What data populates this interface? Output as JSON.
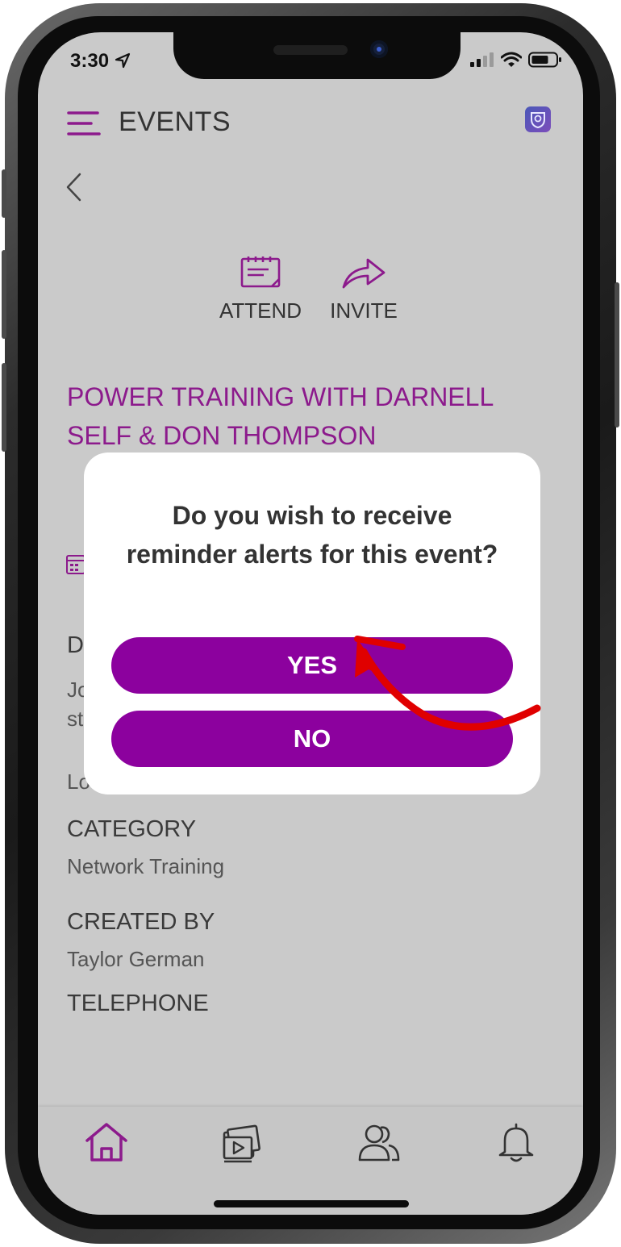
{
  "status_bar": {
    "time": "3:30"
  },
  "header": {
    "title": "EVENTS"
  },
  "actions": {
    "attend_label": "ATTEND",
    "invite_label": "INVITE"
  },
  "event": {
    "title_line1": "POWER TRAINING WITH DARNELL",
    "title_line2": "SELF & DON THOMPSON",
    "description_label_partial": "D",
    "description_line1_partial": "Jo",
    "description_line2_partial": "st",
    "location_partial": "Lo",
    "category_label": "CATEGORY",
    "category_value": "Network Training",
    "created_by_label": "CREATED BY",
    "created_by_value": "Taylor German",
    "telephone_label": "TELEPHONE"
  },
  "modal": {
    "question_line1": "Do you wish to receive",
    "question_line2": "reminder alerts for this event?",
    "yes_label": "YES",
    "no_label": "NO"
  },
  "bottom_nav": {
    "items": [
      {
        "icon": "home-icon",
        "active": true
      },
      {
        "icon": "media-icon",
        "active": false
      },
      {
        "icon": "people-icon",
        "active": false
      },
      {
        "icon": "bell-icon",
        "active": false
      }
    ]
  },
  "colors": {
    "accent": "#8c019e",
    "title_purple": "#8c1a8c",
    "annotation_arrow": "#e00000",
    "screen_background": "#cacaca"
  }
}
